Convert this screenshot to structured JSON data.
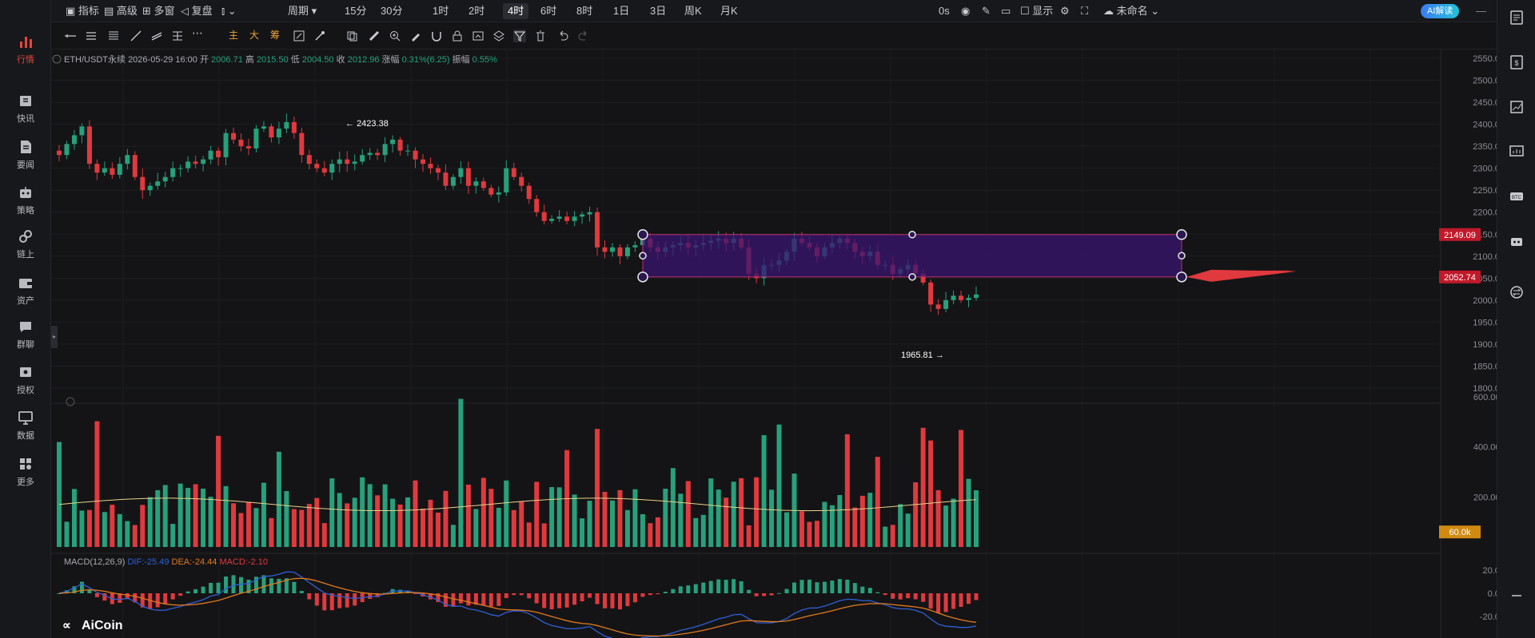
{
  "sidebar": {
    "items": [
      {
        "label": "行情",
        "icon": "bar-chart-icon",
        "active": true
      },
      {
        "label": "快讯",
        "icon": "flash-news-icon"
      },
      {
        "label": "要闻",
        "icon": "document-icon"
      },
      {
        "label": "策略",
        "icon": "robot-icon"
      },
      {
        "label": "链上",
        "icon": "chain-icon"
      },
      {
        "label": "资产",
        "icon": "wallet-icon"
      },
      {
        "label": "群聊",
        "icon": "chat-icon"
      },
      {
        "label": "授权",
        "icon": "key-icon"
      },
      {
        "label": "数据",
        "icon": "monitor-icon"
      },
      {
        "label": "更多",
        "icon": "grid-icon"
      }
    ]
  },
  "toolbar": {
    "indicator": "指标",
    "advanced": "高级",
    "multi_window": "多窗",
    "replay": "复盘",
    "period": "周期",
    "intervals": [
      "15分",
      "30分",
      "1时",
      "2时",
      "4时",
      "6时",
      "8时",
      "1日",
      "3日",
      "周K",
      "月K"
    ],
    "active_interval": "4时",
    "countdown": "0s",
    "display": "显示",
    "layout_name": "未命名",
    "ai_button": "AI解读"
  },
  "draw_tools": {
    "main": "主",
    "large": "大",
    "chip": "筹"
  },
  "info_bar": {
    "symbol": "ETH/USDT永续",
    "time": "2026-05-29 16:00",
    "open_label": "开",
    "open": "2006.71",
    "high_label": "高",
    "high": "2015.50",
    "low_label": "低",
    "low": "2004.50",
    "close_label": "收",
    "close": "2012.96",
    "change_label": "涨幅",
    "change": "0.31%(6.25)",
    "amp_label": "振幅",
    "amp": "0.55%"
  },
  "price_axis": [
    "2550.00",
    "2500.00",
    "2450.00",
    "2400.00",
    "2350.00",
    "2300.00",
    "2250.00",
    "2200.00",
    "2150.00",
    "2100.00",
    "2050.00",
    "2000.00",
    "1950.00",
    "1900.00",
    "1850.00",
    "1800.00"
  ],
  "volume_axis": [
    "600.00k",
    "400.00k",
    "200.00k"
  ],
  "macd_axis": [
    "20.00",
    "0.00",
    "-20.00"
  ],
  "annotations": {
    "high_marker": "2423.38",
    "low_marker": "1965.81"
  },
  "badges": {
    "upper": "2149.09",
    "lower": "2052.74",
    "volume": "60.0k"
  },
  "macd": {
    "label": "MACD(12,26,9)",
    "dif": "DIF:-25.49",
    "dea": "DEA:-24.44",
    "macd": "MACD:-2.10"
  },
  "brand": "AiCoin",
  "colors": {
    "up": "#26a17b",
    "down": "#e0393e",
    "bg": "#141416",
    "rect_fill": "#3a1470",
    "rect_border": "#c03070",
    "dif": "#2f5fd6",
    "dea": "#e07a1f",
    "ma_volume": "#e8d28a",
    "accent": "#e8453c"
  },
  "chart_data": {
    "type": "candlestick",
    "y_range": [
      1800,
      2560
    ],
    "close_path": [
      2330,
      2355,
      2375,
      2395,
      2310,
      2290,
      2300,
      2285,
      2310,
      2330,
      2280,
      2250,
      2260,
      2270,
      2280,
      2300,
      2300,
      2315,
      2310,
      2320,
      2340,
      2325,
      2380,
      2365,
      2350,
      2345,
      2390,
      2395,
      2370,
      2390,
      2405,
      2380,
      2330,
      2310,
      2300,
      2290,
      2310,
      2320,
      2310,
      2315,
      2330,
      2335,
      2330,
      2355,
      2365,
      2340,
      2340,
      2320,
      2310,
      2300,
      2290,
      2260,
      2280,
      2300,
      2260,
      2270,
      2255,
      2240,
      2245,
      2300,
      2280,
      2260,
      2230,
      2200,
      2180,
      2185,
      2190,
      2180,
      2190,
      2195,
      2200,
      2120,
      2110,
      2120,
      2100,
      2120,
      2125,
      2140,
      2120,
      2110,
      2120,
      2125,
      2130,
      2120,
      2125,
      2130,
      2135,
      2140,
      2130,
      2140,
      2120,
      2060,
      2050,
      2080,
      2080,
      2090,
      2110,
      2140,
      2130,
      2120,
      2100,
      2120,
      2130,
      2140,
      2130,
      2110,
      2100,
      2110,
      2080,
      2080,
      2060,
      2070,
      2080,
      2060,
      2040,
      1990,
      1980,
      2000,
      2010,
      2000,
      2005,
      2013
    ]
  }
}
